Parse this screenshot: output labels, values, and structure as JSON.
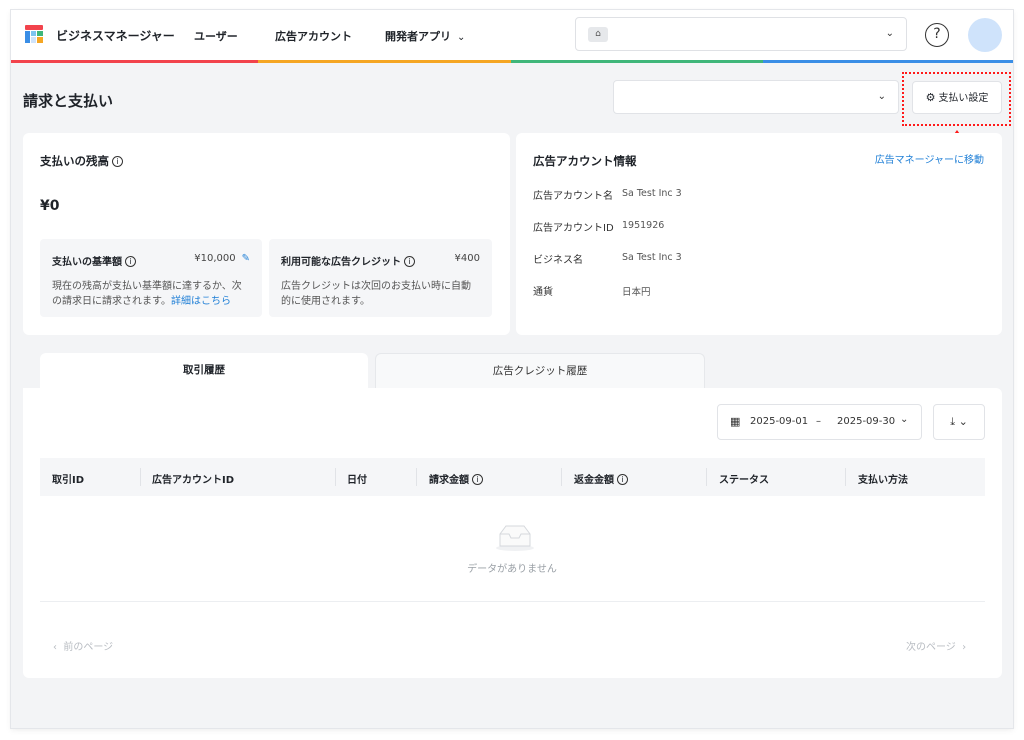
{
  "header": {
    "brand": "ビジネスマネージャー",
    "nav": [
      "ユーザー",
      "広告アカウント",
      "開発者アプリ"
    ],
    "account_select_value": "",
    "help_label": "?",
    "colors": [
      "#f2434c",
      "#f5a623",
      "#3fb67a",
      "#3a8ee6"
    ]
  },
  "page": {
    "title": "請求と支払い",
    "settings_button": "支払い設定",
    "filter_select_value": ""
  },
  "balance_card": {
    "title": "支払いの残高",
    "amount": "¥0",
    "threshold": {
      "label": "支払いの基準額",
      "value": "¥10,000",
      "desc_line1": "現在の残高が支払い基準額に達するか、次",
      "desc_line2": "の請求日に請求されます。",
      "link": "詳細はこちら"
    },
    "credit": {
      "label": "利用可能な広告クレジット",
      "value": "¥400",
      "desc_line1": "広告クレジットは次回のお支払い時に自動",
      "desc_line2": "的に使用されます。"
    }
  },
  "account_card": {
    "title": "広告アカウント情報",
    "link": "広告マネージャーに移動",
    "rows": [
      {
        "key": "広告アカウント名",
        "value": "Sa Test Inc 3"
      },
      {
        "key": "広告アカウントID",
        "value": "1951926"
      },
      {
        "key": "ビジネス名",
        "value": "Sa Test Inc 3"
      },
      {
        "key": "通貨",
        "value": "日本円"
      }
    ]
  },
  "tabs": [
    "取引履歴",
    "広告クレジット履歴"
  ],
  "filters": {
    "date_start": "2025-09-01",
    "date_sep": "–",
    "date_end": "2025-09-30"
  },
  "table": {
    "columns": [
      "取引ID",
      "広告アカウントID",
      "日付",
      "請求金額",
      "返金金額",
      "ステータス",
      "支払い方法"
    ],
    "empty_text": "データがありません"
  },
  "pagination": {
    "prev": "前のページ",
    "next": "次のページ"
  }
}
